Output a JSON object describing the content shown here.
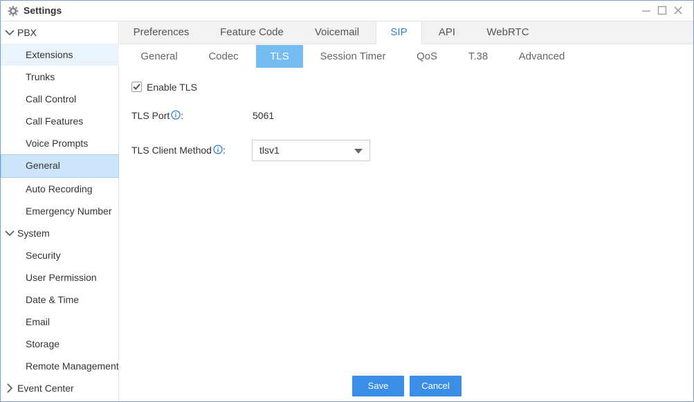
{
  "window": {
    "title": "Settings",
    "icon": "gear-icon",
    "controls": [
      "minimize-icon",
      "maximize-icon",
      "close-icon"
    ]
  },
  "sidebar": {
    "groups": [
      {
        "label": "PBX",
        "expanded": true,
        "items": [
          {
            "label": "Extensions"
          },
          {
            "label": "Trunks"
          },
          {
            "label": "Call Control"
          },
          {
            "label": "Call Features"
          },
          {
            "label": "Voice Prompts"
          },
          {
            "label": "General",
            "selected": true
          },
          {
            "label": "Auto Recording"
          },
          {
            "label": "Emergency Number"
          }
        ]
      },
      {
        "label": "System",
        "expanded": true,
        "items": [
          {
            "label": "Security"
          },
          {
            "label": "User Permission"
          },
          {
            "label": "Date & Time"
          },
          {
            "label": "Email"
          },
          {
            "label": "Storage"
          },
          {
            "label": "Remote Management"
          }
        ]
      },
      {
        "label": "Event Center",
        "expanded": false,
        "items": []
      }
    ]
  },
  "top_tabs": [
    {
      "label": "Preferences"
    },
    {
      "label": "Feature Code"
    },
    {
      "label": "Voicemail"
    },
    {
      "label": "SIP",
      "active": true
    },
    {
      "label": "API"
    },
    {
      "label": "WebRTC"
    }
  ],
  "sub_tabs": [
    {
      "label": "General"
    },
    {
      "label": "Codec"
    },
    {
      "label": "TLS",
      "active": true
    },
    {
      "label": "Session Timer"
    },
    {
      "label": "QoS"
    },
    {
      "label": "T.38"
    },
    {
      "label": "Advanced"
    }
  ],
  "form": {
    "enable_tls": {
      "label": "Enable TLS",
      "checked": true
    },
    "tls_port": {
      "label": "TLS Port",
      "suffix": ":",
      "value": "5061"
    },
    "tls_client_method": {
      "label": "TLS Client Method",
      "suffix": ":",
      "value": "tlsv1"
    }
  },
  "buttons": {
    "save": "Save",
    "cancel": "Cancel"
  },
  "colors": {
    "accent": "#2e82d6",
    "active_subtab": "#75bcf0",
    "button": "#3a8ee6",
    "selected_item": "#cde5fa",
    "highlight_item": "#eaf4fd"
  }
}
